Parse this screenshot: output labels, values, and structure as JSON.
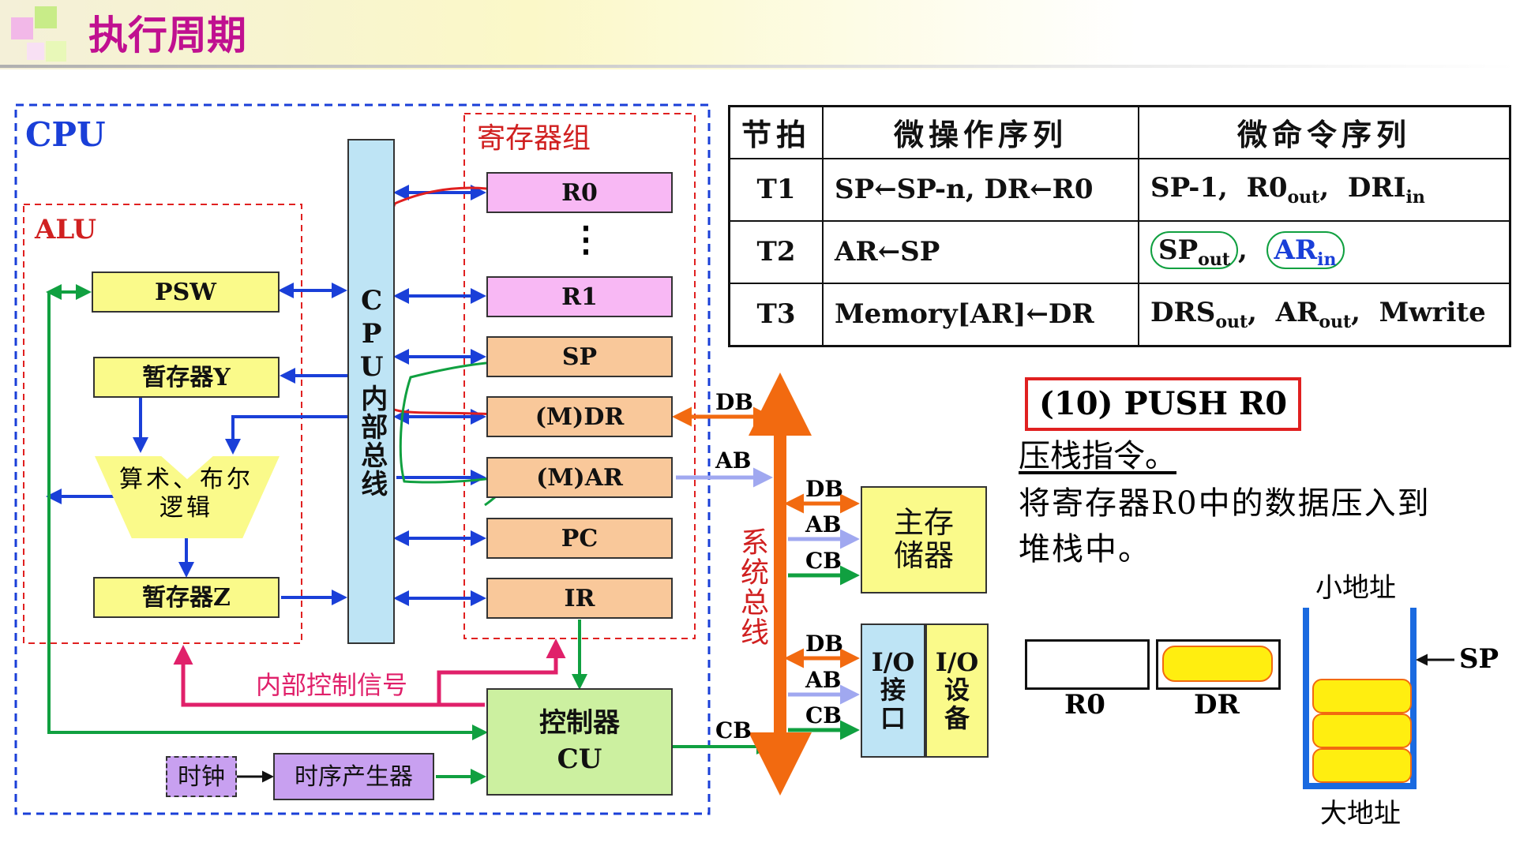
{
  "header": {
    "title": "执行周期",
    "title_color": "#c01090"
  },
  "cpu": {
    "label": "CPU",
    "alu_label": "ALU",
    "regs_label": "寄存器组",
    "bus_label": "CPU内部总线",
    "alu_blocks": {
      "psw": "PSW",
      "y": "暂存器Y",
      "z": "暂存器Z",
      "logic": "算术、布尔逻辑"
    },
    "registers": [
      "R0",
      "⋮",
      "R1",
      "SP",
      "(M)DR",
      "(M)AR",
      "PC",
      "IR"
    ],
    "control": {
      "cu": "控制器\nCU",
      "clock": "时钟",
      "timing": "时序产生器",
      "internal_signal": "内部控制信号"
    }
  },
  "system_bus": {
    "label": "系统总线",
    "db": "DB",
    "ab": "AB",
    "cb": "CB",
    "memory": "主存\n储器",
    "io_interface": "I/O\n接\n口",
    "io_device": "I/O\n设\n备"
  },
  "table": {
    "headers": [
      "节拍",
      "微操作序列",
      "微命令序列"
    ],
    "rows": [
      {
        "beat": "T1",
        "microops": "SP←SP-n, DR←R0",
        "microcmds": [
          [
            "SP-1",
            ""
          ],
          [
            "R0",
            "out"
          ],
          [
            "DRI",
            "in"
          ]
        ]
      },
      {
        "beat": "T2",
        "microops": "AR←SP",
        "microcmds": [
          [
            "SP",
            "out"
          ],
          [
            "AR",
            "in"
          ]
        ]
      },
      {
        "beat": "T3",
        "microops": "Memory[AR]←DR",
        "microcmds": [
          [
            "DRS",
            "out"
          ],
          [
            "AR",
            "out"
          ],
          [
            "Mwrite",
            ""
          ]
        ]
      }
    ]
  },
  "instruction": {
    "title": "(10) PUSH R0",
    "line1": "压栈指令。",
    "line2": "将寄存器R0中的数据压入到",
    "line3": "堆栈中。"
  },
  "stack_demo": {
    "r0": "R0",
    "dr": "DR",
    "small_addr": "小地址",
    "big_addr": "大地址",
    "sp": "SP"
  },
  "colors": {
    "blue_bus": "#1a3fd8",
    "green": "#10a040",
    "magenta": "#e0206a",
    "orange": "#f26a10",
    "lavender": "#a0a8f0",
    "red_box": "#e02020"
  }
}
